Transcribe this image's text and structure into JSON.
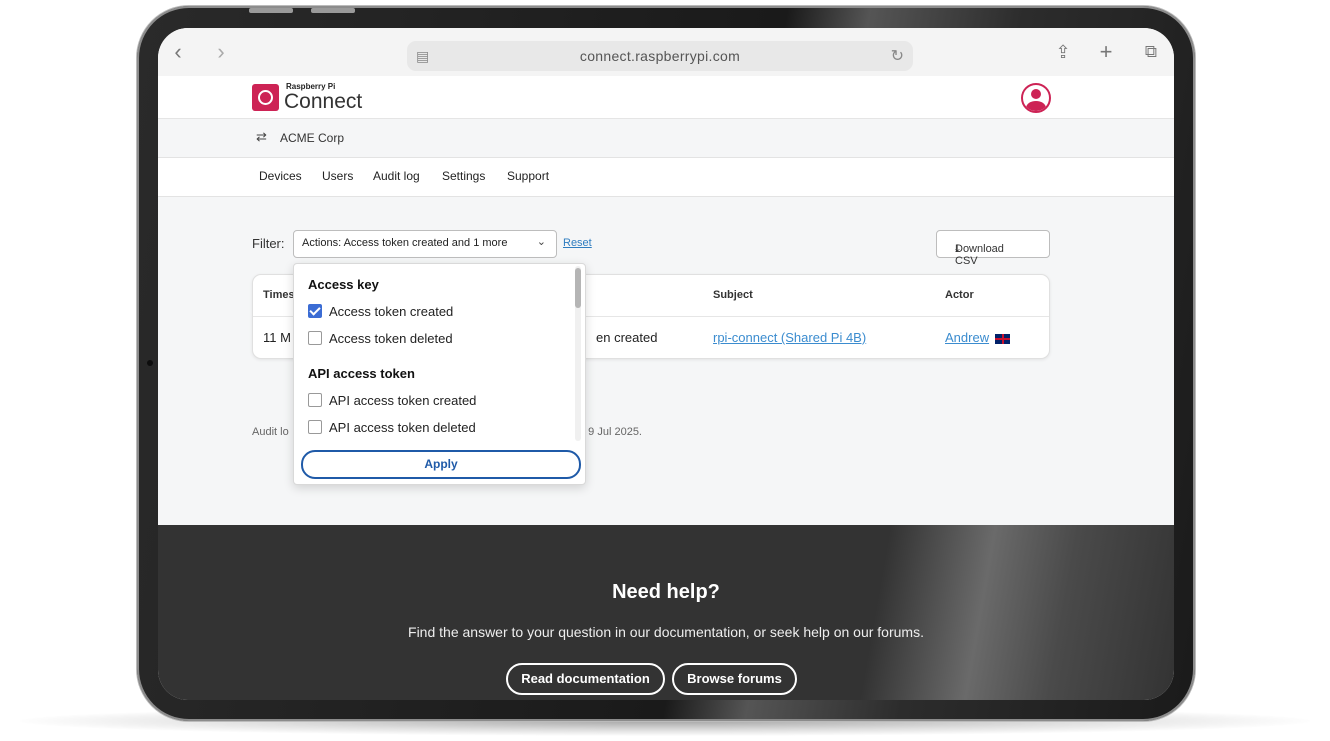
{
  "browser": {
    "url": "connect.raspberrypi.com",
    "icons": [
      "back-icon",
      "forward-icon",
      "tab-overview-icon",
      "reload-icon",
      "share-icon",
      "new-tab-icon",
      "tabs-icon"
    ]
  },
  "brand": {
    "small": "Raspberry Pi",
    "big": "Connect",
    "color": "#cd2355"
  },
  "org": {
    "name": "ACME Corp"
  },
  "nav": [
    "Devices",
    "Users",
    "Audit log",
    "Settings",
    "Support"
  ],
  "filter": {
    "label": "Filter:",
    "value": "Actions: Access token created and 1 more",
    "reset": "Reset",
    "download": "Download CSV"
  },
  "table": {
    "headers": {
      "timestamp": "Times",
      "subject": "Subject",
      "actor": "Actor"
    },
    "row": {
      "timestamp": "11 M",
      "action": "en created",
      "subject": "rpi-connect (Shared Pi 4B)",
      "actor": "Andrew"
    }
  },
  "audit_note": {
    "left": "Audit lo",
    "right": "d 9 Jul 2025."
  },
  "dropdown": {
    "groups": [
      {
        "label": "Access key",
        "options": [
          {
            "label": "Access token created",
            "checked": true
          },
          {
            "label": "Access token deleted",
            "checked": false
          }
        ]
      },
      {
        "label": "API access token",
        "options": [
          {
            "label": "API access token created",
            "checked": false
          },
          {
            "label": "API access token deleted",
            "checked": false
          }
        ]
      }
    ],
    "apply": "Apply"
  },
  "footer": {
    "title": "Need help?",
    "subtitle": "Find the answer to your question in our documentation, or seek help on our forums.",
    "btn_docs": "Read documentation",
    "btn_forums": "Browse forums"
  }
}
